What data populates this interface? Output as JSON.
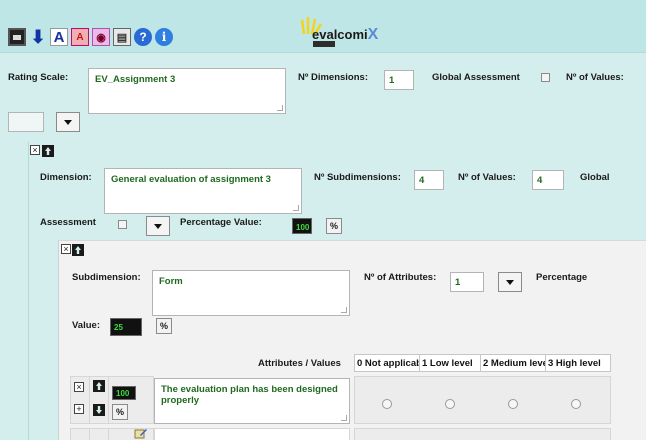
{
  "toolbar": {
    "icons": [
      "save-icon",
      "download-icon",
      "font-large-icon",
      "font-small-icon",
      "eye-icon",
      "document-icon",
      "help-icon",
      "info-icon"
    ],
    "font_large_glyph": "A",
    "font_small_glyph": "A",
    "help_glyph": "?",
    "info_glyph": "i"
  },
  "logo": {
    "text_prefix": "e",
    "text_main": "valcomi",
    "text_x": "X"
  },
  "rating_scale": {
    "label": "Rating Scale:",
    "name": "EV_Assignment 3",
    "dimensions_label": "Nº Dimensions:",
    "dimensions_value": "1",
    "global_assessment_label": "Global Assessment",
    "values_label": "Nº of Values:"
  },
  "dimension": {
    "label": "Dimension:",
    "name": "General evaluation of assignment 3",
    "subdimensions_label": "Nº Subdimensions:",
    "subdimensions_value": "4",
    "values_label": "Nº of Values:",
    "values_value": "4",
    "global_label": "Global",
    "assessment_label": "Assessment",
    "percentage_label": "Percentage Value:",
    "percentage_value": "100",
    "pct_button": "%"
  },
  "subdimension": {
    "label": "Subdimension:",
    "name": "Form",
    "attributes_label": "Nº of Attributes:",
    "attributes_value": "1",
    "percentage_label": "Percentage",
    "value_label": "Value:",
    "value": "25",
    "pct_button": "%"
  },
  "attributes_table": {
    "header_label": "Attributes / Values",
    "columns": [
      "0 Not applicable",
      "1 Low level",
      "2 Medium level",
      "3 High level"
    ],
    "rows": [
      {
        "text": "The evaluation plan has been designed properly",
        "percentage": "100",
        "pct_button": "%"
      }
    ]
  },
  "colors": {
    "top_bar": "#bfe6e6",
    "panel": "#d4eeee",
    "sub_panel": "#f2f2f2",
    "input_text": "#1f6a1f"
  }
}
